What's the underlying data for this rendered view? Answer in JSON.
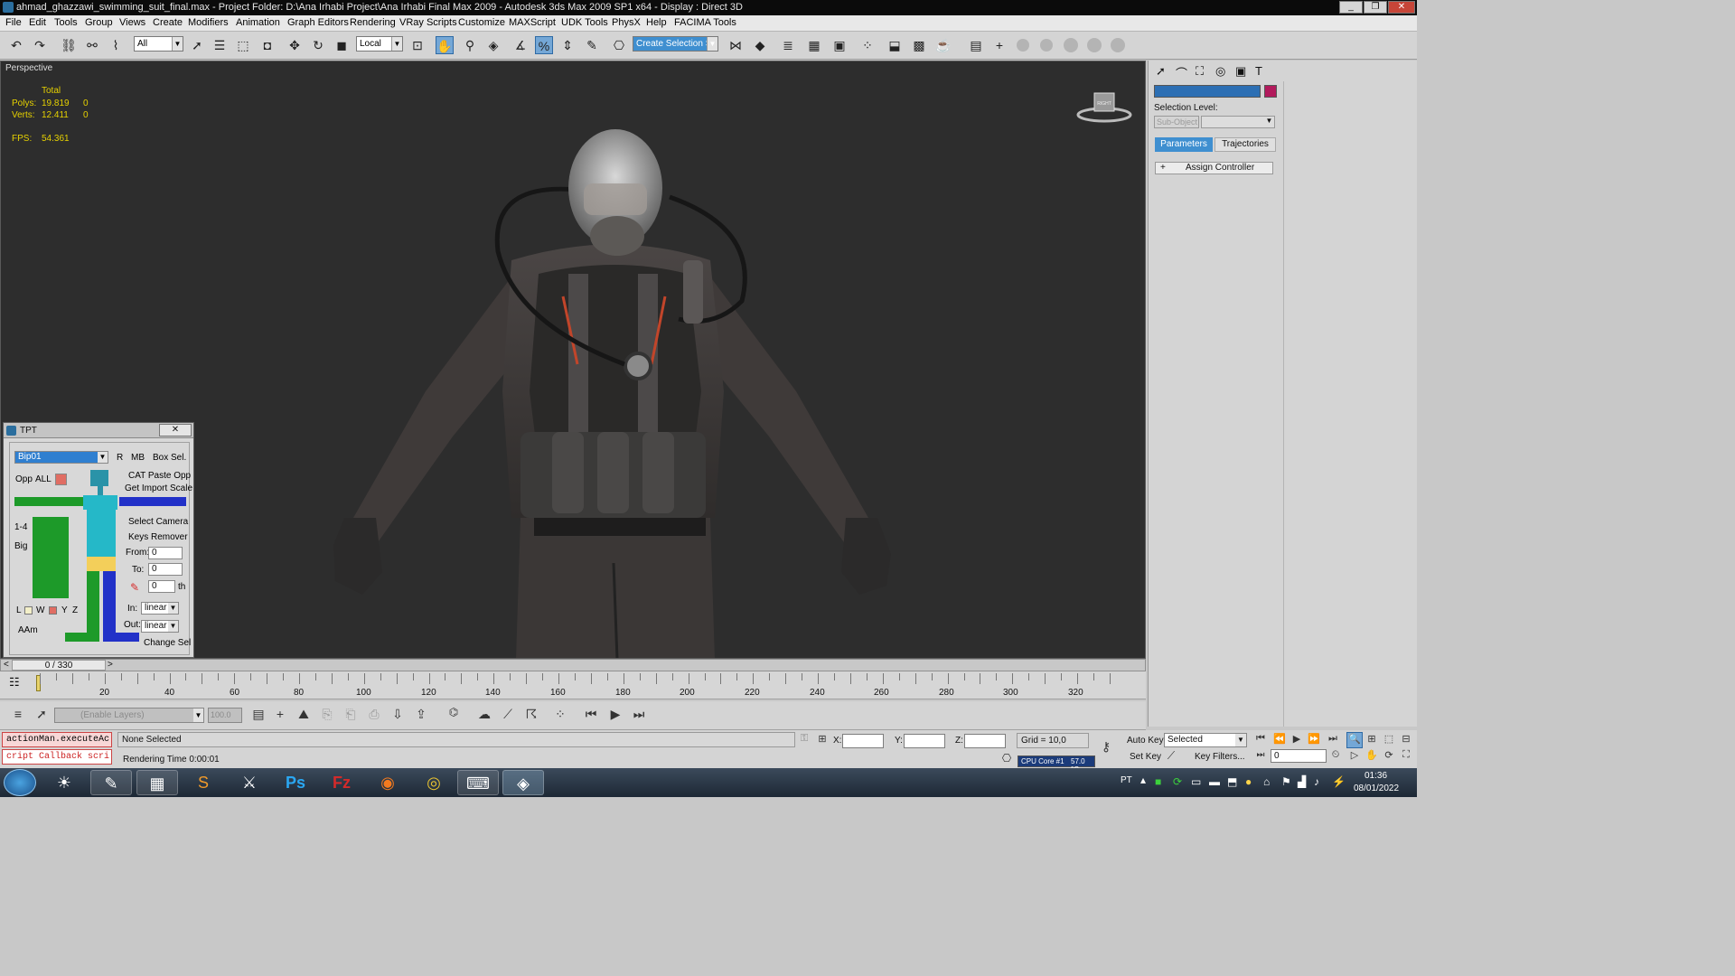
{
  "window": {
    "title": "ahmad_ghazzawi_swimming_suit_final.max    - Project Folder: D:\\Ana Irhabi Project\\Ana Irhabi Final Max 2009    - Autodesk 3ds Max  2009 SP1  x64       - Display : Direct 3D"
  },
  "menu": [
    "File",
    "Edit",
    "Tools",
    "Group",
    "Views",
    "Create",
    "Modifiers",
    "Animation",
    "Graph Editors",
    "Rendering",
    "VRay Scripts",
    "Customize",
    "MAXScript",
    "UDK Tools",
    "PhysX",
    "Help",
    "FACIMA Tools"
  ],
  "toolbar": {
    "filter_value": "All",
    "coord_value": "Local",
    "selection_set_placeholder": "Create Selection Se"
  },
  "viewport": {
    "label": "Perspective",
    "stats": {
      "total_header": "Total",
      "polys_label": "Polys:",
      "polys_value": "19.819",
      "polys_sel": "0",
      "verts_label": "Verts:",
      "verts_value": "12.411",
      "verts_sel": "0",
      "fps_label": "FPS:",
      "fps_value": "54.361"
    },
    "viewcube_label": "RIGHT"
  },
  "tpt": {
    "title": "TPT",
    "close": "✕",
    "bip_value": "Bip01",
    "r_label": "R",
    "mb_label": "MB",
    "box_sel_label": "Box Sel.",
    "opp_label": "Opp",
    "all_label": "ALL",
    "cat_paste_label": "CAT Paste Opp",
    "get_import_label": "Get Import Scale",
    "one_four_label": "1-4",
    "big_label": "Big",
    "select_camera_label": "Select Camera",
    "keys_remover_label": "Keys Remover",
    "from_label": "From:",
    "from_value": "0",
    "to_label": "To:",
    "to_value": "0",
    "th_value": "0",
    "th_label": "th",
    "l_label": "L",
    "w_label": "W",
    "y_label": "Y",
    "z_label": "Z",
    "aam_label": "AAm",
    "in_label": "In:",
    "in_value": "linear",
    "out_label": "Out:",
    "out_value": "linear",
    "change_sel_label": "Change Sel"
  },
  "command_panel": {
    "selection_level_label": "Selection Level:",
    "sub_object_value": "Sub-Object",
    "tab_parameters": "Parameters",
    "tab_trajectories": "Trajectories",
    "assign_controller_label": "Assign Controller",
    "plus_sign": "+"
  },
  "timeline": {
    "frame_counter": "0 / 330",
    "prev_arrow": "<",
    "next_arrow": ">",
    "ticks": [
      "20",
      "40",
      "60",
      "80",
      "100",
      "120",
      "140",
      "160",
      "180",
      "200",
      "220",
      "240",
      "260",
      "280",
      "300",
      "320"
    ]
  },
  "bottom_toolbar": {
    "layers_placeholder": "(Enable Layers)",
    "spinner_value": "100.0"
  },
  "status": {
    "listener_line1": "actionMan.executeAc",
    "listener_line2": "cript Callback scri",
    "selection_status": "None Selected",
    "rendering_time": "Rendering Time  0:00:01",
    "x_label": "X:",
    "y_label": "Y:",
    "z_label": "Z:",
    "grid_label": "Grid = 10,0",
    "auto_key_label": "Auto Key",
    "selected_value": "Selected",
    "set_key_label": "Set Key",
    "key_filters_label": "Key Filters...",
    "current_frame": "0",
    "cpu_label": "CPU Core #1",
    "cpu_temp": "57.0 °C"
  },
  "taskbar": {
    "lang": "PT",
    "time": "01:36",
    "date": "08/01/2022"
  },
  "colors": {
    "viewport_bg": "#2d2d2d",
    "stats_yellow": "#e6d100",
    "accent_blue": "#3f8fd0",
    "swatch_magenta": "#b21a5c",
    "tpt_red": "#e06d63"
  }
}
